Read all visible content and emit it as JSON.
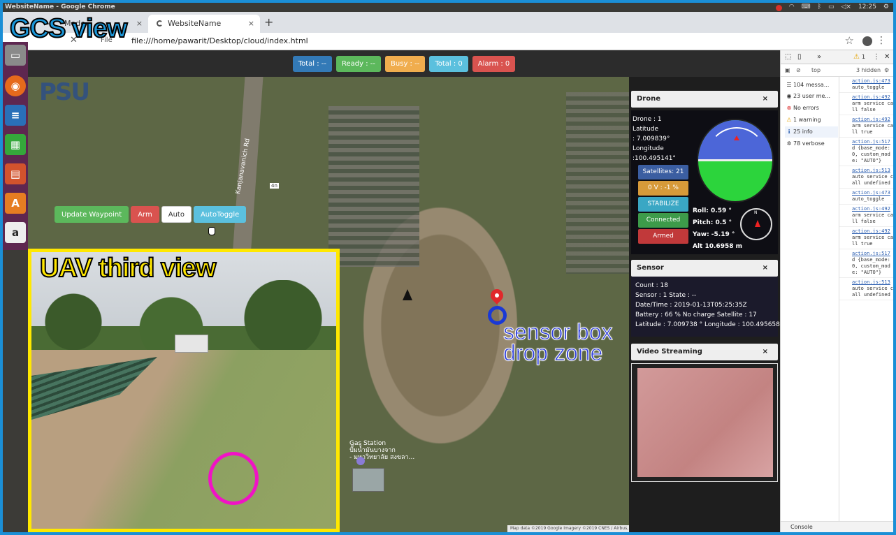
{
  "os": {
    "window_title": "WebsiteName - Google Chrome",
    "clock": "12:25"
  },
  "browser": {
    "tabs": [
      {
        "label": "Mode"
      },
      {
        "label": "WebsiteName"
      }
    ],
    "new_tab": "+",
    "url": "file:///home/pawarit/Desktop/cloud/index.html",
    "info_label": "File"
  },
  "captions": {
    "gcs": "GCS view",
    "uav": "UAV third view",
    "dropzone_line1": "sensor box",
    "dropzone_line2": "drop zone"
  },
  "status_bar": [
    {
      "label": "Total : --",
      "color": "#337ab7"
    },
    {
      "label": "Ready : --",
      "color": "#5cb85c"
    },
    {
      "label": "Busy : --",
      "color": "#f0ad4e"
    },
    {
      "label": "Total : 0",
      "color": "#5bc0de"
    },
    {
      "label": "Alarm : 0",
      "color": "#d9534f"
    }
  ],
  "controls": {
    "update_waypoint": "Update Waypoint",
    "arm": "Arm",
    "auto": "Auto",
    "autotoggle": "AutoToggle"
  },
  "map": {
    "road": "Kanjanavanich Rd",
    "road_sign": "4n",
    "gas_station": "Gas Station",
    "gas_sub": "ปั๊มน้ำมันบางจาก",
    "gas_sub2": "- มหาวิทยาลัย สงขลา...",
    "footer": "Map data ©2019 Google Imagery ©2019 CNES / Airbus, DigitalGlobe  20 m  Terms of Use  Report a map error",
    "logo": "PSU"
  },
  "drone_panel": {
    "title": "Drone",
    "close": "×",
    "drone": "Drone : 1",
    "lat_label": "Latitude",
    "lat": ": 7.009839°",
    "lon_label": "Longitude",
    "lon": ":100.495141°",
    "satellites": "Satellites: 21",
    "voltage": "0 V : -1 %",
    "mode": "STABILIZE",
    "connected": "Connected",
    "armed": "Armed",
    "roll": "Roll:   0.59 °",
    "pitch": "Pitch:  0.5 °",
    "yaw": "Yaw:   -5.19 °",
    "alt": "Alt    10.6958 m"
  },
  "sensor_panel": {
    "title": "Sensor",
    "close": "×",
    "count": "Count : 18",
    "sensor": "Sensor : 1     State : --",
    "datetime": "Date/Time : 2019-01-13T05:25:35Z",
    "battery": "Battery : 66 % No charge   Satellite : 17",
    "position": "Latitude : 7.009738 °  Longitude : 100.495658 °"
  },
  "video_panel": {
    "title": "Video Streaming",
    "close": "×"
  },
  "devtools": {
    "warn_count": "1",
    "context": "top",
    "hidden": "3 hidden",
    "filters": [
      "104 messa...",
      "23 user me...",
      "No errors",
      "1 warning",
      "25 info",
      "78 verbose"
    ],
    "log": [
      {
        "src": "action.js:473",
        "msg": "auto_toggle"
      },
      {
        "src": "action.js:492",
        "msg": "arm service call false"
      },
      {
        "src": "action.js:492",
        "msg": "arm service call true"
      },
      {
        "src": "action.js:517",
        "msg": "d {base_mode: 0, custom_mode: \"AUTO\"}"
      },
      {
        "src": "action.js:513",
        "msg": "auto service call undefined"
      },
      {
        "src": "action.js:473",
        "msg": "auto_toggle"
      },
      {
        "src": "action.js:492",
        "msg": "arm service call false"
      },
      {
        "src": "action.js:492",
        "msg": "arm service call true"
      },
      {
        "src": "action.js:517",
        "msg": "d {base_mode: 0, custom_mode: \"AUTO\"}"
      },
      {
        "src": "action.js:513",
        "msg": "auto service call undefined"
      }
    ],
    "console_tab": "Console"
  }
}
